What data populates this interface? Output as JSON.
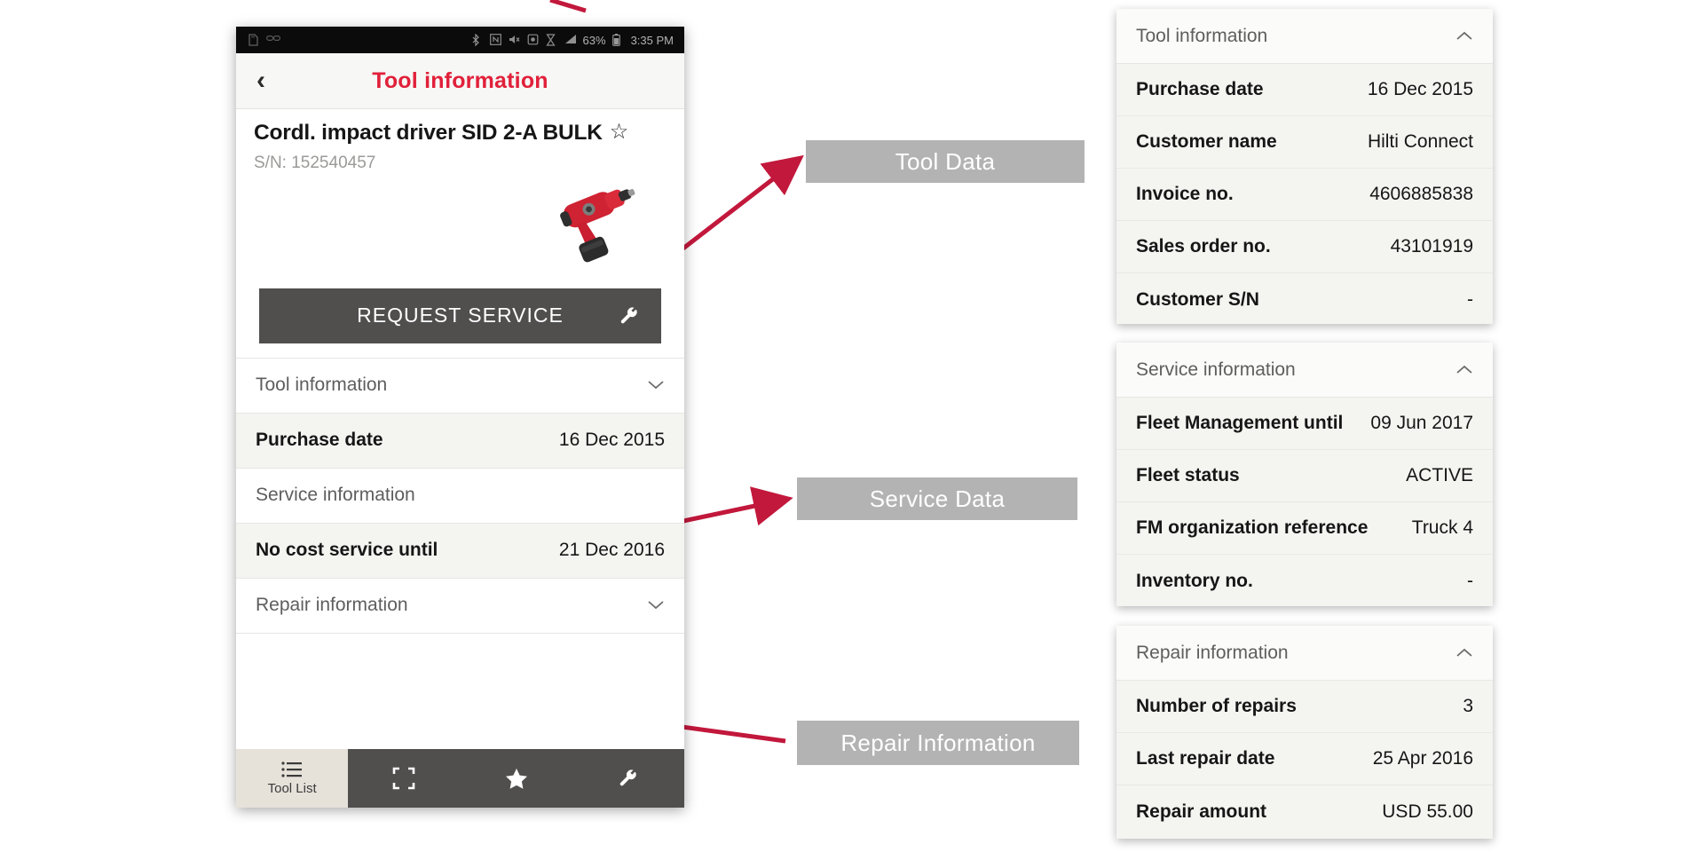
{
  "phone": {
    "status_bar": {
      "battery": "63%",
      "time": "3:35 PM",
      "icons": [
        "sd-card-icon",
        "link-icon",
        "bluetooth-icon",
        "nfc-icon",
        "mute-icon",
        "alarm-icon",
        "hourglass-icon",
        "signal-icon",
        "battery-icon"
      ]
    },
    "app_bar": {
      "back_label": "‹",
      "title": "Tool information"
    },
    "tool": {
      "name": "Cordl. impact driver SID 2-A BULK",
      "favorite_star": "☆",
      "serial": "S/N: 152540457"
    },
    "request_service_button": {
      "label": "REQUEST SERVICE",
      "icon": "wrench-icon"
    },
    "rows": [
      {
        "type": "section",
        "label": "Tool information",
        "chevron": "⌄"
      },
      {
        "type": "kv",
        "key": "Purchase date",
        "value": "16 Dec 2015"
      },
      {
        "type": "section",
        "label": "Service information",
        "chevron": "⌄"
      },
      {
        "type": "kv",
        "key": "No cost service until",
        "value": "21 Dec 2016"
      },
      {
        "type": "section",
        "label": "Repair information",
        "chevron": "⌄"
      }
    ],
    "bottom_nav": [
      {
        "label": "Tool List",
        "icon": "list-icon",
        "active": true
      },
      {
        "label": "",
        "icon": "scan-icon",
        "active": false
      },
      {
        "label": "",
        "icon": "star-icon",
        "active": false
      },
      {
        "label": "",
        "icon": "wrench-icon",
        "active": false
      }
    ]
  },
  "callouts": [
    {
      "label": "Tool Data"
    },
    {
      "label": "Service Data"
    },
    {
      "label": "Repair Information"
    }
  ],
  "panels": [
    {
      "title": "Tool information",
      "chevron": "˄",
      "rows": [
        {
          "key": "Purchase date",
          "value": "16 Dec 2015"
        },
        {
          "key": "Customer name",
          "value": "Hilti Connect"
        },
        {
          "key": "Invoice no.",
          "value": "4606885838"
        },
        {
          "key": "Sales order no.",
          "value": "43101919"
        },
        {
          "key": "Customer S/N",
          "value": "-"
        }
      ]
    },
    {
      "title": "Service information",
      "chevron": "˄",
      "rows": [
        {
          "key": "Fleet Management until",
          "value": "09 Jun 2017"
        },
        {
          "key": "Fleet status",
          "value": "ACTIVE"
        },
        {
          "key": "FM organization reference",
          "value": "Truck 4"
        },
        {
          "key": "Inventory no.",
          "value": "-"
        }
      ]
    },
    {
      "title": "Repair information",
      "chevron": "˄",
      "rows": [
        {
          "key": "Number of repairs",
          "value": "3"
        },
        {
          "key": "Last repair date",
          "value": "25 Apr 2016"
        },
        {
          "key": "Repair amount",
          "value": "USD 55.00"
        }
      ]
    }
  ],
  "colors": {
    "accent_red": "#e1203a",
    "arrow_red": "#c2183c",
    "dark_button": "#514e4e",
    "callout_gray": "#b3b3b3",
    "row_alt": "#f4f4f1"
  }
}
